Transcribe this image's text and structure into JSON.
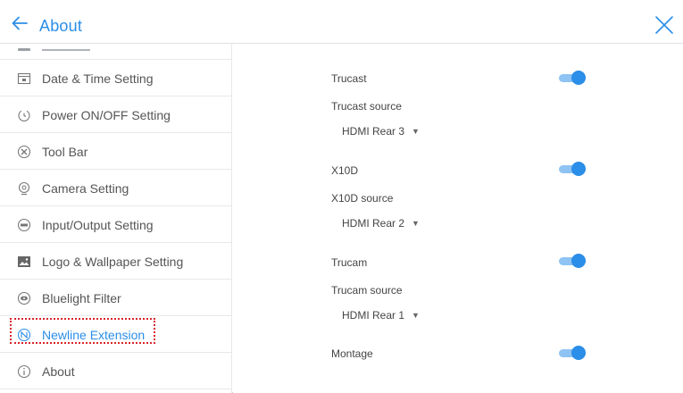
{
  "header": {
    "title": "About",
    "back_icon": "arrow-left-icon",
    "close_icon": "close-icon",
    "accent_color": "#2b8ee8"
  },
  "sidebar": {
    "items": [
      {
        "label": "Date & Time Setting",
        "icon": "calendar-icon"
      },
      {
        "label": "Power ON/OFF Setting",
        "icon": "power-icon"
      },
      {
        "label": "Tool Bar",
        "icon": "tools-icon"
      },
      {
        "label": "Camera Setting",
        "icon": "camera-icon"
      },
      {
        "label": "Input/Output Setting",
        "icon": "input-output-icon"
      },
      {
        "label": "Logo & Wallpaper Setting",
        "icon": "image-icon"
      },
      {
        "label": "Bluelight Filter",
        "icon": "eye-filter-icon"
      },
      {
        "label": "Newline Extension",
        "icon": "extension-icon",
        "active": true
      },
      {
        "label": "About",
        "icon": "info-icon"
      }
    ]
  },
  "content": {
    "settings": [
      {
        "label": "Trucast",
        "toggle_on": true
      },
      {
        "label": "Trucast source",
        "value": "HDMI Rear 3"
      },
      {
        "label": "X10D",
        "toggle_on": true
      },
      {
        "label": "X10D source",
        "value": "HDMI Rear 2"
      },
      {
        "label": "Trucam",
        "toggle_on": true
      },
      {
        "label": "Trucam source",
        "value": "HDMI Rear 1"
      },
      {
        "label": "Montage",
        "toggle_on": true
      }
    ]
  }
}
